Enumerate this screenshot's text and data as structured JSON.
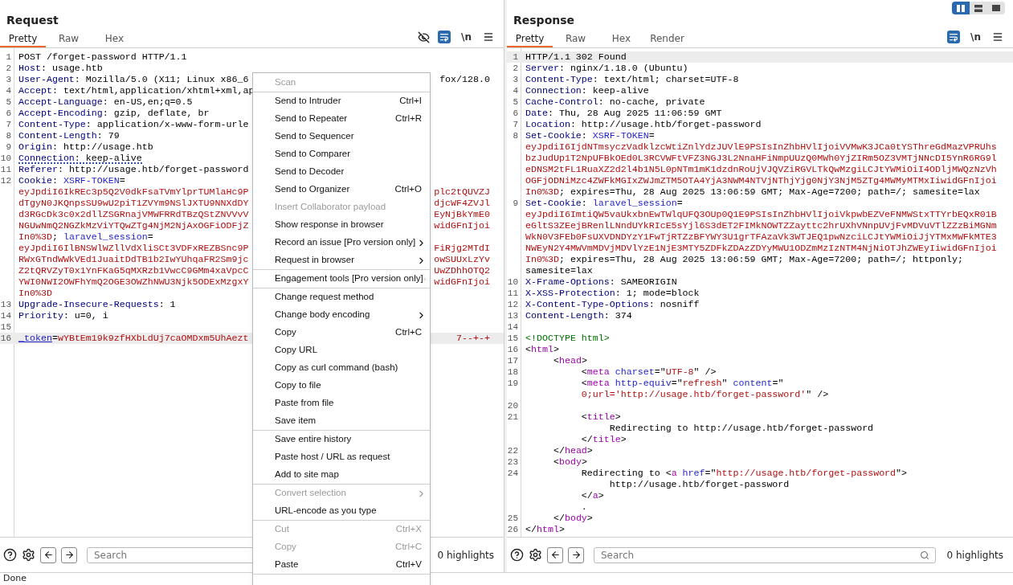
{
  "layout_toggle": [
    {
      "kind": "split",
      "selected": true
    },
    {
      "kind": "stack",
      "selected": false
    },
    {
      "kind": "single",
      "selected": false
    }
  ],
  "request": {
    "title": "Request",
    "tabs": [
      {
        "label": "Pretty",
        "selected": true
      },
      {
        "label": "Raw",
        "selected": false
      },
      {
        "label": "Hex",
        "selected": false
      }
    ],
    "toolbar": [
      {
        "kind": "hide"
      },
      {
        "kind": "wrap",
        "selected": true
      },
      {
        "kind": "newline",
        "label": "\\n"
      },
      {
        "kind": "menu"
      }
    ],
    "lines": [
      {
        "number": "1",
        "rows": [
          {
            "left": [
              {
                "kind": "plain",
                "text": "POST /forget-password HTTP/1.1"
              }
            ]
          }
        ]
      },
      {
        "number": "2",
        "rows": [
          {
            "left": [
              {
                "kind": "name",
                "text": "Host"
              },
              {
                "kind": "plain",
                "text": ": usage.htb"
              }
            ]
          }
        ]
      },
      {
        "number": "3",
        "rows": [
          {
            "left": [
              {
                "kind": "name",
                "text": "User-Agent"
              },
              {
                "kind": "plain",
                "text": ": Mozilla/5.0 (X11; Linux x86_6"
              }
            ],
            "right": [
              {
                "kind": "plain",
                "text": "fox/128.0"
              }
            ]
          }
        ]
      },
      {
        "number": "4",
        "rows": [
          {
            "left": [
              {
                "kind": "name",
                "text": "Accept"
              },
              {
                "kind": "plain",
                "text": ": text/html,application/xhtml+xml,ap"
              }
            ]
          }
        ]
      },
      {
        "number": "5",
        "rows": [
          {
            "left": [
              {
                "kind": "name",
                "text": "Accept-Language"
              },
              {
                "kind": "plain",
                "text": ": en-US,en;q=0.5"
              }
            ]
          }
        ]
      },
      {
        "number": "6",
        "rows": [
          {
            "left": [
              {
                "kind": "name",
                "text": "Accept-Encoding"
              },
              {
                "kind": "plain",
                "text": ": gzip, deflate, br"
              }
            ]
          }
        ]
      },
      {
        "number": "7",
        "rows": [
          {
            "left": [
              {
                "kind": "name",
                "text": "Content-Type"
              },
              {
                "kind": "plain",
                "text": ": application/x-www-form-urle"
              }
            ]
          }
        ]
      },
      {
        "number": "8",
        "rows": [
          {
            "left": [
              {
                "kind": "name",
                "text": "Content-Length"
              },
              {
                "kind": "plain",
                "text": ": 79"
              }
            ]
          }
        ]
      },
      {
        "number": "9",
        "rows": [
          {
            "left": [
              {
                "kind": "name",
                "text": "Origin"
              },
              {
                "kind": "plain",
                "text": ": http://usage.htb"
              }
            ]
          }
        ]
      },
      {
        "number": "10",
        "marked": true,
        "rows": [
          {
            "left": [
              {
                "kind": "name",
                "text": "Connection"
              },
              {
                "kind": "plain",
                "text": ": keep-alive"
              }
            ]
          }
        ]
      },
      {
        "number": "11",
        "rows": [
          {
            "left": [
              {
                "kind": "name",
                "text": "Referer"
              },
              {
                "kind": "plain",
                "text": ": http://usage.htb/forget-password"
              }
            ]
          }
        ]
      },
      {
        "number": "12",
        "rows": [
          {
            "left": [
              {
                "kind": "name",
                "text": "Cookie"
              },
              {
                "kind": "plain",
                "text": ": "
              },
              {
                "kind": "cookie",
                "text": "XSRF-TOKEN"
              },
              {
                "kind": "plain",
                "text": "="
              }
            ]
          },
          {
            "left": [
              {
                "kind": "secret",
                "text": "eyJpdiI6IkREc3p5Q2V0dkFsaTVmYlprTUMlaHc9P"
              }
            ],
            "right": [
              {
                "kind": "secret",
                "text": "plc2tQUVZJ"
              }
            ]
          },
          {
            "left": [
              {
                "kind": "secret",
                "text": "dTgyN0JKQnpsSU9wU2piT1ZVYm9NSlJXTU9NNXdDY"
              }
            ],
            "right": [
              {
                "kind": "secret",
                "text": "djcWF4ZVJl"
              }
            ]
          },
          {
            "left": [
              {
                "kind": "secret",
                "text": "d3RGcDk3c0x2dllZSGRnajVMWFRRdTBzQStZNVVvV"
              }
            ],
            "right": [
              {
                "kind": "secret",
                "text": "EyNjBkYmE0"
              }
            ]
          },
          {
            "left": [
              {
                "kind": "secret",
                "text": "NGUwNmQ2NGZkMzViYTQwZTg4NjM2NjAxOGFiODFjZ"
              }
            ],
            "right": [
              {
                "kind": "secret",
                "text": "widGFnIjoi"
              }
            ]
          },
          {
            "left": [
              {
                "kind": "secret",
                "text": "In0%3D"
              },
              {
                "kind": "plain",
                "text": "; "
              },
              {
                "kind": "cookie",
                "text": "laravel_session"
              },
              {
                "kind": "plain",
                "text": "="
              }
            ]
          },
          {
            "left": [
              {
                "kind": "secret",
                "text": "eyJpdiI6IlBNSWlWZllVdXliSCt3VDFxREZBSnc9P"
              }
            ],
            "right": [
              {
                "kind": "secret",
                "text": "FiRjg2MTdI"
              }
            ]
          },
          {
            "left": [
              {
                "kind": "secret",
                "text": "RWxGTndWWkVEd1JuaitDdTB1b2IwYUhqaFR2Sm9jc"
              }
            ],
            "right": [
              {
                "kind": "secret",
                "text": "owSUUxLzYv"
              }
            ]
          },
          {
            "left": [
              {
                "kind": "secret",
                "text": "Z2tQRVZyT0x1YnFKaG5qMXRzb1VwcC9GMm4xaVpcC"
              }
            ],
            "right": [
              {
                "kind": "secret",
                "text": "UwZDhhOTQ2"
              }
            ]
          },
          {
            "left": [
              {
                "kind": "secret",
                "text": "YWI0NWI2OWFhYmQ2OGE3OWZhNWU3Njk5ODExMzgxY"
              }
            ],
            "right": [
              {
                "kind": "secret",
                "text": "widGFnIjoi"
              }
            ]
          },
          {
            "left": [
              {
                "kind": "secret",
                "text": "In0%3D"
              }
            ]
          }
        ]
      },
      {
        "number": "13",
        "rows": [
          {
            "left": [
              {
                "kind": "name",
                "text": "Upgrade-Insecure-Requests"
              },
              {
                "kind": "plain",
                "text": ": 1"
              }
            ]
          }
        ]
      },
      {
        "number": "14",
        "rows": [
          {
            "left": [
              {
                "kind": "name",
                "text": "Priority"
              },
              {
                "kind": "plain",
                "text": ": u=0, i"
              }
            ]
          }
        ]
      },
      {
        "number": "15"
      },
      {
        "number": "16",
        "current": true,
        "rows": [
          {
            "left": [
              {
                "kind": "cookie",
                "text": "_token"
              },
              {
                "kind": "plain",
                "text": "="
              },
              {
                "kind": "secret",
                "text": "wYBtEm19k9zfHXbLdUj7caOMDxm5UhAezt"
              }
            ],
            "right": [
              {
                "kind": "secret",
                "text": "7--+-+"
              }
            ]
          }
        ]
      }
    ],
    "footer": {
      "search_placeholder": "Search",
      "highlights": "0 highlights"
    }
  },
  "response": {
    "title": "Response",
    "tabs": [
      {
        "label": "Pretty",
        "selected": true
      },
      {
        "label": "Raw",
        "selected": false
      },
      {
        "label": "Hex",
        "selected": false
      },
      {
        "label": "Render",
        "selected": false
      }
    ],
    "toolbar": [
      {
        "kind": "wrap",
        "selected": true
      },
      {
        "kind": "newline",
        "label": "\\n"
      },
      {
        "kind": "menu"
      }
    ],
    "lines": [
      {
        "number": "1",
        "current": true,
        "rows": [
          {
            "left": [
              {
                "kind": "plain",
                "text": "HTTP/1.1 302 Found"
              }
            ]
          }
        ]
      },
      {
        "number": "2",
        "rows": [
          {
            "left": [
              {
                "kind": "name",
                "text": "Server"
              },
              {
                "kind": "plain",
                "text": ": nginx/1.18.0 (Ubuntu)"
              }
            ]
          }
        ]
      },
      {
        "number": "3",
        "rows": [
          {
            "left": [
              {
                "kind": "name",
                "text": "Content-Type"
              },
              {
                "kind": "plain",
                "text": ": text/html; charset=UTF-8"
              }
            ]
          }
        ]
      },
      {
        "number": "4",
        "rows": [
          {
            "left": [
              {
                "kind": "name",
                "text": "Connection"
              },
              {
                "kind": "plain",
                "text": ": keep-alive"
              }
            ]
          }
        ]
      },
      {
        "number": "5",
        "rows": [
          {
            "left": [
              {
                "kind": "name",
                "text": "Cache-Control"
              },
              {
                "kind": "plain",
                "text": ": no-cache, private"
              }
            ]
          }
        ]
      },
      {
        "number": "6",
        "rows": [
          {
            "left": [
              {
                "kind": "name",
                "text": "Date"
              },
              {
                "kind": "plain",
                "text": ": Thu, 28 Aug 2025 11:06:59 GMT"
              }
            ]
          }
        ]
      },
      {
        "number": "7",
        "rows": [
          {
            "left": [
              {
                "kind": "name",
                "text": "Location"
              },
              {
                "kind": "plain",
                "text": ": http://usage.htb/forget-password"
              }
            ]
          }
        ]
      },
      {
        "number": "8",
        "rows": [
          {
            "left": [
              {
                "kind": "name",
                "text": "Set-Cookie"
              },
              {
                "kind": "plain",
                "text": ": "
              },
              {
                "kind": "cookie",
                "text": "XSRF-TOKEN"
              },
              {
                "kind": "plain",
                "text": "="
              }
            ]
          },
          {
            "left": [
              {
                "kind": "secret",
                "text": "eyJpdiI6IjdNTmsyczVadklzcWtiZnlYdzJUVlE9PSIsInZhbHVlIjoiVVMwK3JCa0tYSThreGdMazVPRUhs"
              }
            ]
          },
          {
            "left": [
              {
                "kind": "secret",
                "text": "bzJudUp1T2NpUFBkOEd0L3RCVWFtVFZ3NGJ3L2NnaHFiNmpUUzQ0MWh0YjZIRm5OZ3VMTjNNcDI5YnR6RG9l"
              }
            ]
          },
          {
            "left": [
              {
                "kind": "secret",
                "text": "eDNSM2tFL1RuaXZ2d2l4b1N5L0pNTm1mK1dzdnRoUjVJQVZiRGVLTkQwMzgiLCJtYWMiOiI4ODljMWQzNzVh"
              }
            ]
          },
          {
            "left": [
              {
                "kind": "secret",
                "text": "OGFjODNiMzc4ZWFkMGIxZWJmZTM5OTA4YjA3NWM4NTVjNThjYjg0NjY3NjM5ZTg4MWMyMTMxIiwidGFnIjoi"
              }
            ]
          },
          {
            "left": [
              {
                "kind": "secret",
                "text": "In0%3D"
              },
              {
                "kind": "plain",
                "text": "; expires=Thu, 28 Aug 2025 13:06:59 GMT; Max-Age=7200; path=/; samesite=lax"
              }
            ]
          }
        ]
      },
      {
        "number": "9",
        "rows": [
          {
            "left": [
              {
                "kind": "name",
                "text": "Set-Cookie"
              },
              {
                "kind": "plain",
                "text": ": "
              },
              {
                "kind": "cookie",
                "text": "laravel_session"
              },
              {
                "kind": "plain",
                "text": "="
              }
            ]
          },
          {
            "left": [
              {
                "kind": "secret",
                "text": "eyJpdiI6ImtiQW5vaUkxbnEwTWlqUFQ3OUp0Q1E9PSIsInZhbHVlIjoiVkpwbEZVeFNMWStxTTYrbEQxR01B"
              }
            ]
          },
          {
            "left": [
              {
                "kind": "secret",
                "text": "eGltS3ZEejBRenlLNndUYkRIcE5sYjl6S3dET2FIMkNOWTZZayttc2hrUXhVNnpUVjFvMDVuVTlZZzBiMGNm"
              }
            ]
          },
          {
            "left": [
              {
                "kind": "secret",
                "text": "WkN0V3FEb0FsUXVDNDYzY1FwTjRTZzBFYWY3U1grTFAzaVk3WTJEQ1pwNzciLCJtYWMiOiJjYTMxMWFkMTE3"
              }
            ]
          },
          {
            "left": [
              {
                "kind": "secret",
                "text": "NWEyN2Y4MWVmMDVjMDVlYzE1NjE3MTY5ZDFkZDAzZDYyMWU1ODZmMzIzNTM4NjNiOTJhZWEyIiwidGFnIjoi"
              }
            ]
          },
          {
            "left": [
              {
                "kind": "secret",
                "text": "In0%3D"
              },
              {
                "kind": "plain",
                "text": "; expires=Thu, 28 Aug 2025 13:06:59 GMT; Max-Age=7200; path=/; httponly;"
              }
            ]
          },
          {
            "left": [
              {
                "kind": "plain",
                "text": "samesite=lax"
              }
            ]
          }
        ]
      },
      {
        "number": "10",
        "rows": [
          {
            "left": [
              {
                "kind": "name",
                "text": "X-Frame-Options"
              },
              {
                "kind": "plain",
                "text": ": SAMEORIGIN"
              }
            ]
          }
        ]
      },
      {
        "number": "11",
        "rows": [
          {
            "left": [
              {
                "kind": "name",
                "text": "X-XSS-Protection"
              },
              {
                "kind": "plain",
                "text": ": 1; mode=block"
              }
            ]
          }
        ]
      },
      {
        "number": "12",
        "rows": [
          {
            "left": [
              {
                "kind": "name",
                "text": "X-Content-Type-Options"
              },
              {
                "kind": "plain",
                "text": ": nosniff"
              }
            ]
          }
        ]
      },
      {
        "number": "13",
        "rows": [
          {
            "left": [
              {
                "kind": "name",
                "text": "Content-Length"
              },
              {
                "kind": "plain",
                "text": ": 374"
              }
            ]
          }
        ]
      },
      {
        "number": "14"
      },
      {
        "number": "15",
        "rows": [
          {
            "left": [
              {
                "kind": "doctype",
                "text": "<!DOCTYPE html>"
              }
            ]
          }
        ]
      },
      {
        "number": "16",
        "rows": [
          {
            "left": [
              {
                "kind": "plain",
                "text": "<"
              },
              {
                "kind": "tag",
                "text": "html"
              },
              {
                "kind": "plain",
                "text": ">"
              }
            ]
          }
        ]
      },
      {
        "number": "17",
        "rows": [
          {
            "left": [
              {
                "kind": "plain",
                "text": "     <"
              },
              {
                "kind": "tag",
                "text": "head"
              },
              {
                "kind": "plain",
                "text": ">"
              }
            ]
          }
        ]
      },
      {
        "number": "18",
        "rows": [
          {
            "left": [
              {
                "kind": "plain",
                "text": "          <"
              },
              {
                "kind": "tag",
                "text": "meta"
              },
              {
                "kind": "attr",
                "text": " charset"
              },
              {
                "kind": "plain",
                "text": "=\""
              },
              {
                "kind": "string",
                "text": "UTF-8"
              },
              {
                "kind": "plain",
                "text": "\" />"
              }
            ]
          }
        ]
      },
      {
        "number": "19",
        "rows": [
          {
            "left": [
              {
                "kind": "plain",
                "text": "          <"
              },
              {
                "kind": "tag",
                "text": "meta"
              },
              {
                "kind": "attr",
                "text": " http-equiv"
              },
              {
                "kind": "plain",
                "text": "=\""
              },
              {
                "kind": "string",
                "text": "refresh"
              },
              {
                "kind": "plain",
                "text": "\" "
              },
              {
                "kind": "attr",
                "text": "content"
              },
              {
                "kind": "plain",
                "text": "=\""
              }
            ]
          },
          {
            "left": [
              {
                "kind": "string",
                "text": "          0;url='http://usage.htb/forget-password'"
              },
              {
                "kind": "plain",
                "text": "\" />"
              }
            ]
          }
        ]
      },
      {
        "number": "20"
      },
      {
        "number": "21",
        "rows": [
          {
            "left": [
              {
                "kind": "plain",
                "text": "          <"
              },
              {
                "kind": "tag",
                "text": "title"
              },
              {
                "kind": "plain",
                "text": ">"
              }
            ]
          },
          {
            "left": [
              {
                "kind": "plain",
                "text": "               Redirecting to http://usage.htb/forget-password"
              }
            ]
          },
          {
            "left": [
              {
                "kind": "plain",
                "text": "          </"
              },
              {
                "kind": "tag",
                "text": "title"
              },
              {
                "kind": "plain",
                "text": ">"
              }
            ]
          }
        ]
      },
      {
        "number": "22",
        "rows": [
          {
            "left": [
              {
                "kind": "plain",
                "text": "     </"
              },
              {
                "kind": "tag",
                "text": "head"
              },
              {
                "kind": "plain",
                "text": ">"
              }
            ]
          }
        ]
      },
      {
        "number": "23",
        "rows": [
          {
            "left": [
              {
                "kind": "plain",
                "text": "     <"
              },
              {
                "kind": "tag",
                "text": "body"
              },
              {
                "kind": "plain",
                "text": ">"
              }
            ]
          }
        ]
      },
      {
        "number": "24",
        "rows": [
          {
            "left": [
              {
                "kind": "plain",
                "text": "          Redirecting to <"
              },
              {
                "kind": "tag",
                "text": "a"
              },
              {
                "kind": "attr",
                "text": " href"
              },
              {
                "kind": "plain",
                "text": "=\""
              },
              {
                "kind": "string",
                "text": "http://usage.htb/forget-password"
              },
              {
                "kind": "plain",
                "text": "\">"
              }
            ]
          },
          {
            "left": [
              {
                "kind": "plain",
                "text": "               http://usage.htb/forget-password"
              }
            ]
          },
          {
            "left": [
              {
                "kind": "plain",
                "text": "          </"
              },
              {
                "kind": "tag",
                "text": "a"
              },
              {
                "kind": "plain",
                "text": ">"
              }
            ]
          },
          {
            "left": [
              {
                "kind": "plain",
                "text": "          ."
              }
            ]
          }
        ]
      },
      {
        "number": "25",
        "rows": [
          {
            "left": [
              {
                "kind": "plain",
                "text": "     </"
              },
              {
                "kind": "tag",
                "text": "body"
              },
              {
                "kind": "plain",
                "text": ">"
              }
            ]
          }
        ]
      },
      {
        "number": "26",
        "rows": [
          {
            "left": [
              {
                "kind": "plain",
                "text": "</"
              },
              {
                "kind": "tag",
                "text": "html"
              },
              {
                "kind": "plain",
                "text": ">"
              }
            ]
          }
        ]
      }
    ],
    "footer": {
      "search_placeholder": "Search",
      "highlights": "0 highlights"
    }
  },
  "context_menu": [
    {
      "label": "Scan",
      "disabled": true
    },
    {
      "label": "Send to Intruder",
      "shortcut": "Ctrl+I",
      "separator_before": true
    },
    {
      "label": "Send to Repeater",
      "shortcut": "Ctrl+R"
    },
    {
      "label": "Send to Sequencer"
    },
    {
      "label": "Send to Comparer"
    },
    {
      "label": "Send to Decoder"
    },
    {
      "label": "Send to Organizer",
      "shortcut": "Ctrl+O"
    },
    {
      "label": "Insert Collaborator payload",
      "disabled": true
    },
    {
      "label": "Show response in browser"
    },
    {
      "label": "Record an issue [Pro version only]",
      "submenu": true
    },
    {
      "label": "Request in browser",
      "submenu": true
    },
    {
      "label": "Engagement tools [Pro version only]",
      "submenu": true,
      "separator_before": true
    },
    {
      "label": "Change request method",
      "separator_before": true
    },
    {
      "label": "Change body encoding",
      "submenu": true
    },
    {
      "label": "Copy",
      "shortcut": "Ctrl+C"
    },
    {
      "label": "Copy URL"
    },
    {
      "label": "Copy as curl command (bash)"
    },
    {
      "label": "Copy to file"
    },
    {
      "label": "Paste from file"
    },
    {
      "label": "Save item"
    },
    {
      "label": "Save entire history",
      "separator_before": true
    },
    {
      "label": "Paste host / URL as request"
    },
    {
      "label": "Add to site map"
    },
    {
      "label": "Convert selection",
      "disabled": true,
      "submenu": true,
      "separator_before": true
    },
    {
      "label": "URL-encode as you type"
    },
    {
      "label": "Cut",
      "shortcut": "Ctrl+X",
      "disabled": true,
      "separator_before": true
    },
    {
      "label": "Copy",
      "shortcut": "Ctrl+C",
      "disabled": true
    },
    {
      "label": "Paste",
      "shortcut": "Ctrl+V"
    }
  ],
  "status_bar": {
    "text": "Done"
  }
}
